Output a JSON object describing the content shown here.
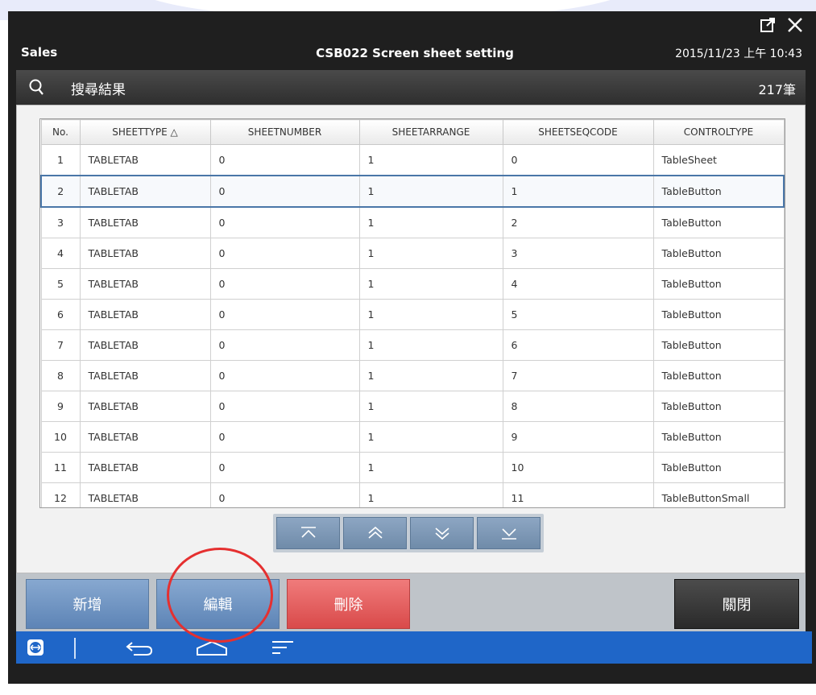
{
  "window": {
    "app_name": "Sales",
    "screen_title": "CSB022 Screen sheet setting",
    "datetime": "2015/11/23 上午 10:43"
  },
  "search": {
    "label": "搜尋結果",
    "count": "217筆"
  },
  "table": {
    "headers": [
      "No.",
      "SHEETTYPE △",
      "SHEETNUMBER",
      "SHEETARRANGE",
      "SHEETSEQCODE",
      "CONTROLTYPE"
    ],
    "rows": [
      [
        "1",
        "TABLETAB",
        "0",
        "1",
        "0",
        "TableSheet"
      ],
      [
        "2",
        "TABLETAB",
        "0",
        "1",
        "1",
        "TableButton"
      ],
      [
        "3",
        "TABLETAB",
        "0",
        "1",
        "2",
        "TableButton"
      ],
      [
        "4",
        "TABLETAB",
        "0",
        "1",
        "3",
        "TableButton"
      ],
      [
        "5",
        "TABLETAB",
        "0",
        "1",
        "4",
        "TableButton"
      ],
      [
        "6",
        "TABLETAB",
        "0",
        "1",
        "5",
        "TableButton"
      ],
      [
        "7",
        "TABLETAB",
        "0",
        "1",
        "6",
        "TableButton"
      ],
      [
        "8",
        "TABLETAB",
        "0",
        "1",
        "7",
        "TableButton"
      ],
      [
        "9",
        "TABLETAB",
        "0",
        "1",
        "8",
        "TableButton"
      ],
      [
        "10",
        "TABLETAB",
        "0",
        "1",
        "9",
        "TableButton"
      ],
      [
        "11",
        "TABLETAB",
        "0",
        "1",
        "10",
        "TableButton"
      ],
      [
        "12",
        "TABLETAB",
        "0",
        "1",
        "11",
        "TableButtonSmall"
      ]
    ],
    "selected_row": 2
  },
  "actions": {
    "add": "新增",
    "edit": "編輯",
    "delete": "刪除",
    "close": "關閉"
  },
  "icons": {
    "external": "external-link-icon",
    "close": "close-icon",
    "search": "search-icon",
    "pager": [
      "first-page-icon",
      "previous-page-icon",
      "next-page-icon",
      "last-page-icon"
    ],
    "nav": [
      "teamviewer-icon",
      "back-icon",
      "home-icon",
      "menu-icon"
    ]
  },
  "colors": {
    "nav_blue": "#1f66c8",
    "delete_red": "#d94a4a",
    "edit_blue": "#5d84b6",
    "highlight_circle": "#e53030"
  }
}
